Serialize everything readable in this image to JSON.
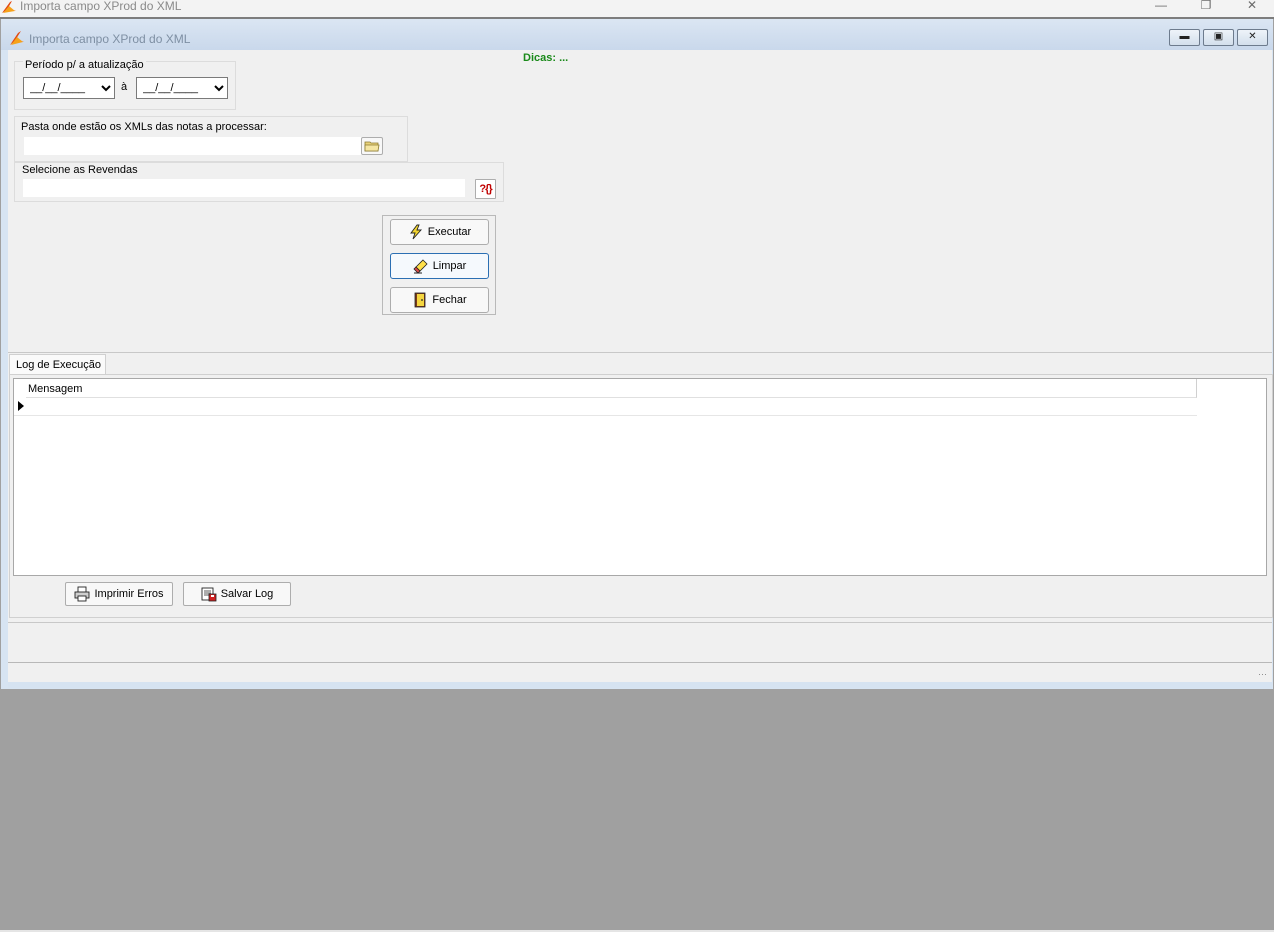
{
  "app": {
    "title": "Importa campo XProd do XML"
  },
  "window": {
    "title": "Importa campo XProd do XML"
  },
  "tips": {
    "label": "Dicas: ..."
  },
  "period": {
    "legend": "Período p/ a atualização",
    "from_value": "__/__/____",
    "separator": "à",
    "to_value": "__/__/____"
  },
  "folder": {
    "label": "Pasta onde estão os XMLs das notas a processar:",
    "value": ""
  },
  "dealers": {
    "label": "Selecione as Revendas",
    "value": "",
    "lookup_text": "?{}"
  },
  "actions": {
    "execute_label": "Executar",
    "clear_label": "Limpar",
    "close_label": "Fechar"
  },
  "log": {
    "tab_label": "Log de Execução",
    "columns": [
      "Mensagem"
    ],
    "rows": [
      ""
    ],
    "print_errors_label": "Imprimir Erros",
    "save_log_label": "Salvar Log"
  },
  "colors": {
    "tips_green": "#1a8a1a",
    "focus_blue": "#2b6fb3",
    "desktop_gray": "#a0a0a0"
  },
  "icons": [
    "app-logo-icon",
    "folder-icon",
    "lookup-icon",
    "lightning-icon",
    "eraser-icon",
    "door-icon",
    "printer-icon",
    "save-icon",
    "row-pointer-icon"
  ]
}
